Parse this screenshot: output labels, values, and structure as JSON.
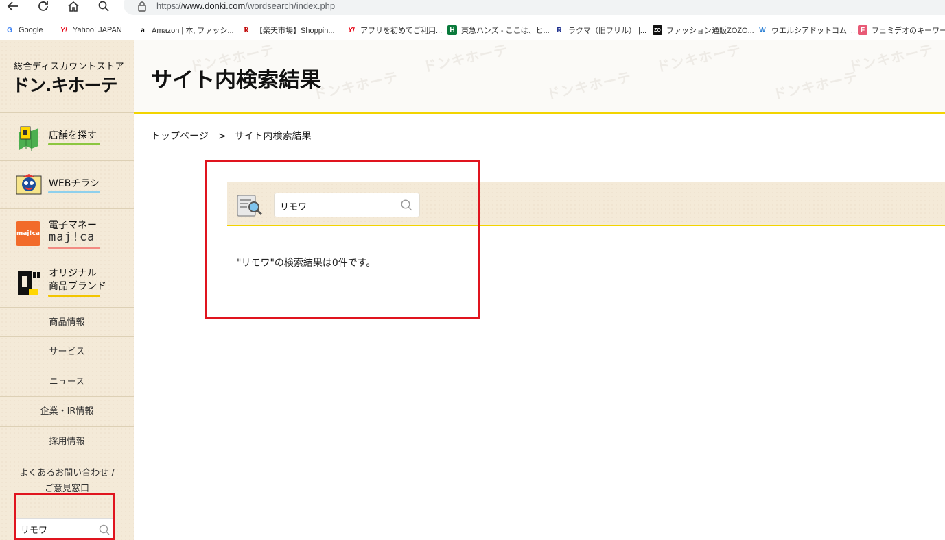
{
  "browser": {
    "url_prefix": "https://",
    "url_domain": "www.donki.com",
    "url_path": "/wordsearch/index.php",
    "bookmarks": [
      {
        "label": "Google",
        "icon": "G"
      },
      {
        "label": "Yahoo! JAPAN",
        "icon": "Y!"
      },
      {
        "label": "Amazon | 本, ファッシ...",
        "icon": "a"
      },
      {
        "label": "【楽天市場】Shoppin...",
        "icon": "R"
      },
      {
        "label": "アプリを初めてご利用...",
        "icon": "Y!"
      },
      {
        "label": "東急ハンズ - ここは、ヒ...",
        "icon": "H"
      },
      {
        "label": "ラクマ（旧フリル） |...",
        "icon": "R"
      },
      {
        "label": "ファッション通販ZOZO...",
        "icon": "ZO"
      },
      {
        "label": "ウエルシアドットコム |...",
        "icon": "W"
      },
      {
        "label": "フェミデオのキーワード検",
        "icon": "F"
      }
    ]
  },
  "logo": {
    "subtitle": "総合ディスカウントストア",
    "name": "ドン.キホーテ"
  },
  "sidebar": {
    "big_items": [
      {
        "label": "店舗を探す",
        "icon": "map-icon"
      },
      {
        "label": "WEBチラシ",
        "icon": "donpen-icon"
      },
      {
        "label_1": "電子マネー",
        "label_2": "maj!ca",
        "icon": "majica-icon"
      },
      {
        "label_1": "オリジナル",
        "label_2": "商品ブランド",
        "icon": "brand-icon"
      }
    ],
    "small_items": [
      "商品情報",
      "サービス",
      "ニュース",
      "企業・IR情報",
      "採用情報"
    ],
    "contact_1": "よくあるお問い合わせ /",
    "contact_2": "ご意見窓口",
    "search_value": "リモワ"
  },
  "header": {
    "title": "サイト内検索結果",
    "pattern_text": "ドンキホーテ"
  },
  "breadcrumb": {
    "home": "トップページ",
    "separator": ">",
    "current": "サイト内検索結果"
  },
  "search": {
    "value": "リモワ",
    "result_message": "\"リモワ\"の検索結果は0件です。"
  },
  "colors": {
    "accent_yellow": "#f2d400",
    "highlight_red": "#e0141e",
    "sidebar_bg": "#f4ead8"
  }
}
